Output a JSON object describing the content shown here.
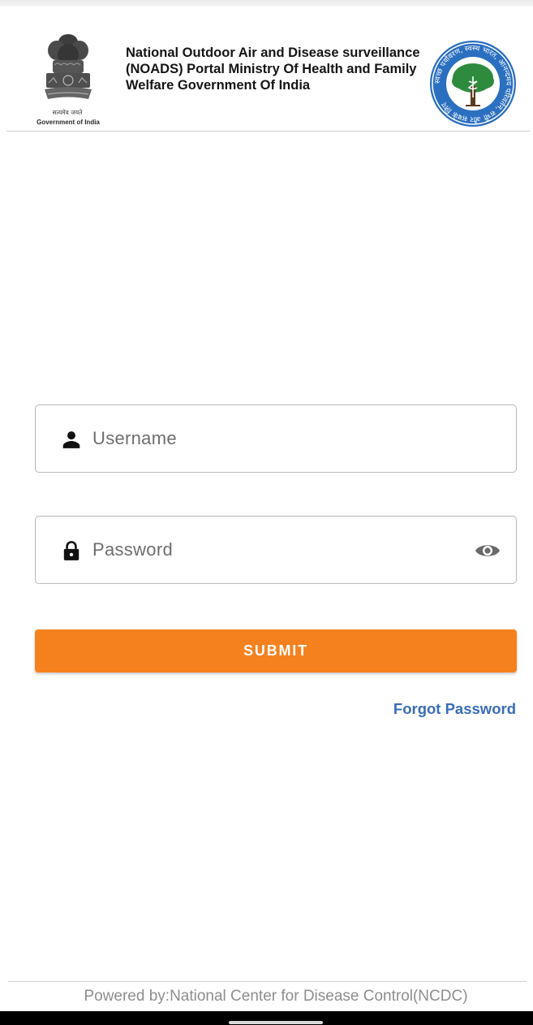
{
  "header": {
    "emblem": {
      "motto": "सत्यमेव जयते",
      "caption": "Government of India"
    },
    "title": "National Outdoor Air and Disease surveillance (NOADS) Portal Ministry Of Health and Family Welfare Government Of India",
    "ncdc_logo": {
      "ring_text": "स्वच्छ पर्यावरण, स्वस्थ भारत, आनन्दमय परिवर्तन, सभी और सबके लिए"
    }
  },
  "login": {
    "username_placeholder": "Username",
    "password_placeholder": "Password",
    "submit_label": "SUBMIT",
    "forgot_label": "Forgot Password"
  },
  "footer": {
    "text": "Powered by:National Center for Disease Control(NCDC)"
  },
  "colors": {
    "accent": "#f5811e",
    "link": "#3a6cb6",
    "logo_blue": "#2b6fc0",
    "logo_green": "#2e8b3e"
  },
  "icons": {
    "username_field": "person-icon",
    "password_field": "lock-icon",
    "password_toggle": "eye-icon"
  }
}
